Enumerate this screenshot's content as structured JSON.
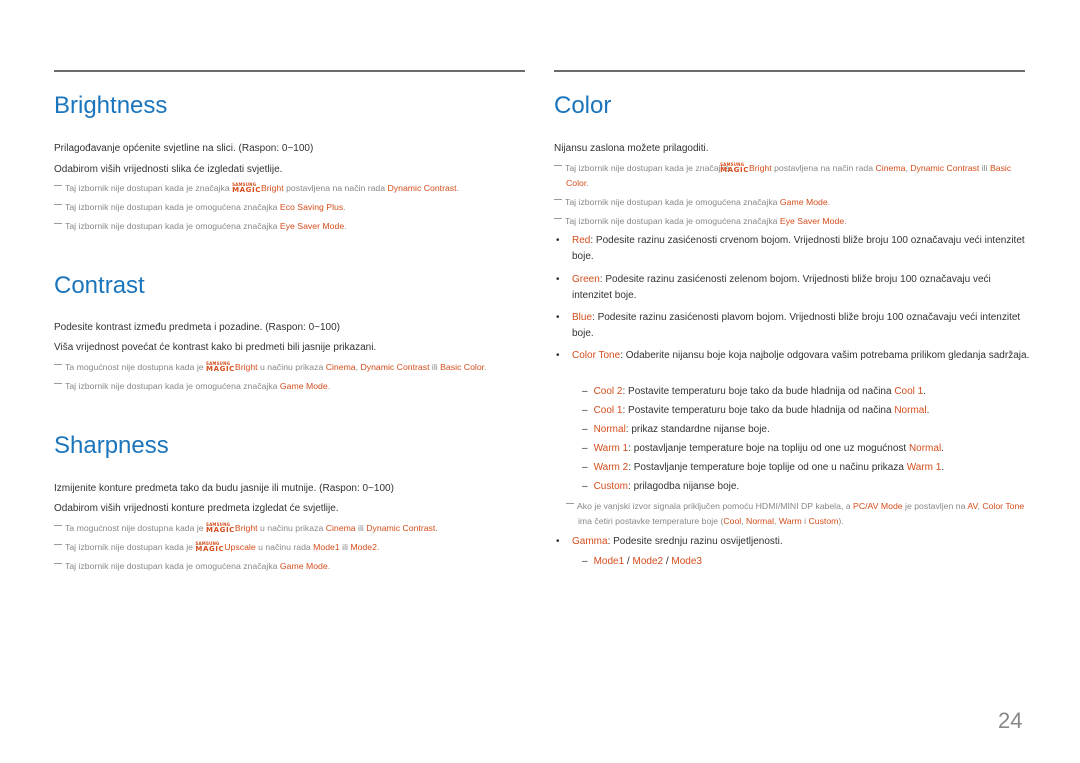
{
  "page_number": "24",
  "colors": {
    "heading": "#1b75bc",
    "highlight": "#d54d1c",
    "note": "#888888",
    "body": "#333333"
  },
  "magic_logo": {
    "top": "SAMSUNG",
    "bottom": "MAGIC"
  },
  "brightness": {
    "title": "Brightness",
    "lines": [
      "Prilagođavanje općenite svjetline na slici. (Raspon: 0~100)",
      "Odabirom viših vrijednosti slika će izgledati svjetlije."
    ],
    "notes": [
      {
        "a": "Taj izbornik nije dostupan kada je značajka ",
        "magic": "Bright",
        "b": " postavljena na način rada ",
        "h1": "Dynamic Contrast",
        "c": "."
      },
      {
        "a": "Taj izbornik nije dostupan kada je omogućena značajka ",
        "h1": "Eco Saving Plus",
        "c": "."
      },
      {
        "a": "Taj izbornik nije dostupan kada je omogućena značajka ",
        "h1": "Eye Saver Mode",
        "c": "."
      }
    ]
  },
  "contrast": {
    "title": "Contrast",
    "lines": [
      "Podesite kontrast između predmeta i pozadine. (Raspon: 0~100)",
      "Viša vrijednost povećat će kontrast kako bi predmeti bili jasnije prikazani."
    ],
    "notes": [
      {
        "a": "Ta mogućnost nije dostupna kada je ",
        "magic": "Bright",
        "b": " u načinu prikaza ",
        "h1": "Cinema",
        "s1": ", ",
        "h2": "Dynamic Contrast",
        "s2": " ili ",
        "h3": "Basic Color",
        "c": "."
      },
      {
        "a": "Taj izbornik nije dostupan kada je omogućena značajka ",
        "h1": "Game Mode",
        "c": "."
      }
    ]
  },
  "sharpness": {
    "title": "Sharpness",
    "lines": [
      "Izmijenite konture predmeta tako da budu jasnije ili mutnije. (Raspon: 0~100)",
      "Odabirom viših vrijednosti konture predmeta izgledat će svjetlije."
    ],
    "notes": [
      {
        "a": "Ta mogućnost nije dostupna kada je ",
        "magic": "Bright",
        "b": " u načinu prikaza ",
        "h1": "Cinema",
        "s1": " ili ",
        "h2": "Dynamic Contrast",
        "c": "."
      },
      {
        "a": "Taj izbornik nije dostupan kada je ",
        "magic": "Upscale",
        "b": " u načinu rada ",
        "h1": "Mode1",
        "s1": " ili ",
        "h2": "Mode2",
        "c": "."
      },
      {
        "a": "Taj izbornik nije dostupan kada je omogućena značajka ",
        "h1": "Game Mode",
        "c": "."
      }
    ]
  },
  "color": {
    "title": "Color",
    "intro": "Nijansu zaslona možete prilagoditi.",
    "notes": [
      {
        "a": "Taj izbornik nije dostupan kada je značajka ",
        "magic": "Bright",
        "b": " postavljena na način rada ",
        "h1": "Cinema",
        "s1": ", ",
        "h2": "Dynamic Contrast",
        "s2": " ili ",
        "h3": "Basic Color",
        "c": "."
      },
      {
        "a": "Taj izbornik nije dostupan kada je omogućena značajka ",
        "h1": "Game Mode",
        "c": "."
      },
      {
        "a": "Taj izbornik nije dostupan kada je omogućena značajka ",
        "h1": "Eye Saver Mode",
        "c": "."
      }
    ],
    "bullets": [
      {
        "label": "Red",
        "text": ": Podesite razinu zasićenosti crvenom bojom. Vrijednosti bliže broju 100 označavaju veći intenzitet boje."
      },
      {
        "label": "Green",
        "text": ": Podesite razinu zasićenosti zelenom bojom. Vrijednosti bliže broju 100 označavaju veći intenzitet boje."
      },
      {
        "label": "Blue",
        "text": ": Podesite razinu zasićenosti plavom bojom. Vrijednosti bliže broju 100 označavaju veći intenzitet boje."
      },
      {
        "label": "Color Tone",
        "text": ": Odaberite nijansu boje koja najbolje odgovara vašim potrebama prilikom gledanja sadržaja."
      }
    ],
    "tones": [
      {
        "label": "Cool 2",
        "text": ": Postavite temperaturu boje tako da bude hladnija od načina ",
        "ref": "Cool 1",
        "end": "."
      },
      {
        "label": "Cool 1",
        "text": ": Postavite temperaturu boje tako da bude hladnija od načina ",
        "ref": "Normal",
        "end": "."
      },
      {
        "label": "Normal",
        "text": ": prikaz standardne nijanse boje.",
        "ref": "",
        "end": ""
      },
      {
        "label": "Warm 1",
        "text": ": postavljanje temperature boje na topliju od one uz mogućnost ",
        "ref": "Normal",
        "end": "."
      },
      {
        "label": "Warm 2",
        "text": ": Postavljanje temperature boje toplije od one u načinu prikaza ",
        "ref": "Warm 1",
        "end": "."
      },
      {
        "label": "Custom",
        "text": ": prilagodba nijanse boje.",
        "ref": "",
        "end": ""
      }
    ],
    "tone_note": {
      "a": "Ako je vanjski izvor signala priključen pomoću HDMI/MINI DP kabela, a ",
      "h1": "PC/AV Mode",
      "b": " je postavljen na ",
      "h2": "AV",
      "s1": ", ",
      "h3": "Color Tone",
      "c": " ima četiri postavke temperature boje (",
      "h4": "Cool",
      "s2": ", ",
      "h5": "Normal",
      "s3": ", ",
      "h6": "Warm",
      "s4": " i ",
      "h7": "Custom",
      "d": ")."
    },
    "gamma": {
      "label": "Gamma",
      "text": ": Podesite srednju razinu osvijetljenosti."
    },
    "gamma_modes": {
      "m1": "Mode1",
      "sep1": " / ",
      "m2": "Mode2",
      "sep2": " / ",
      "m3": "Mode3"
    }
  }
}
